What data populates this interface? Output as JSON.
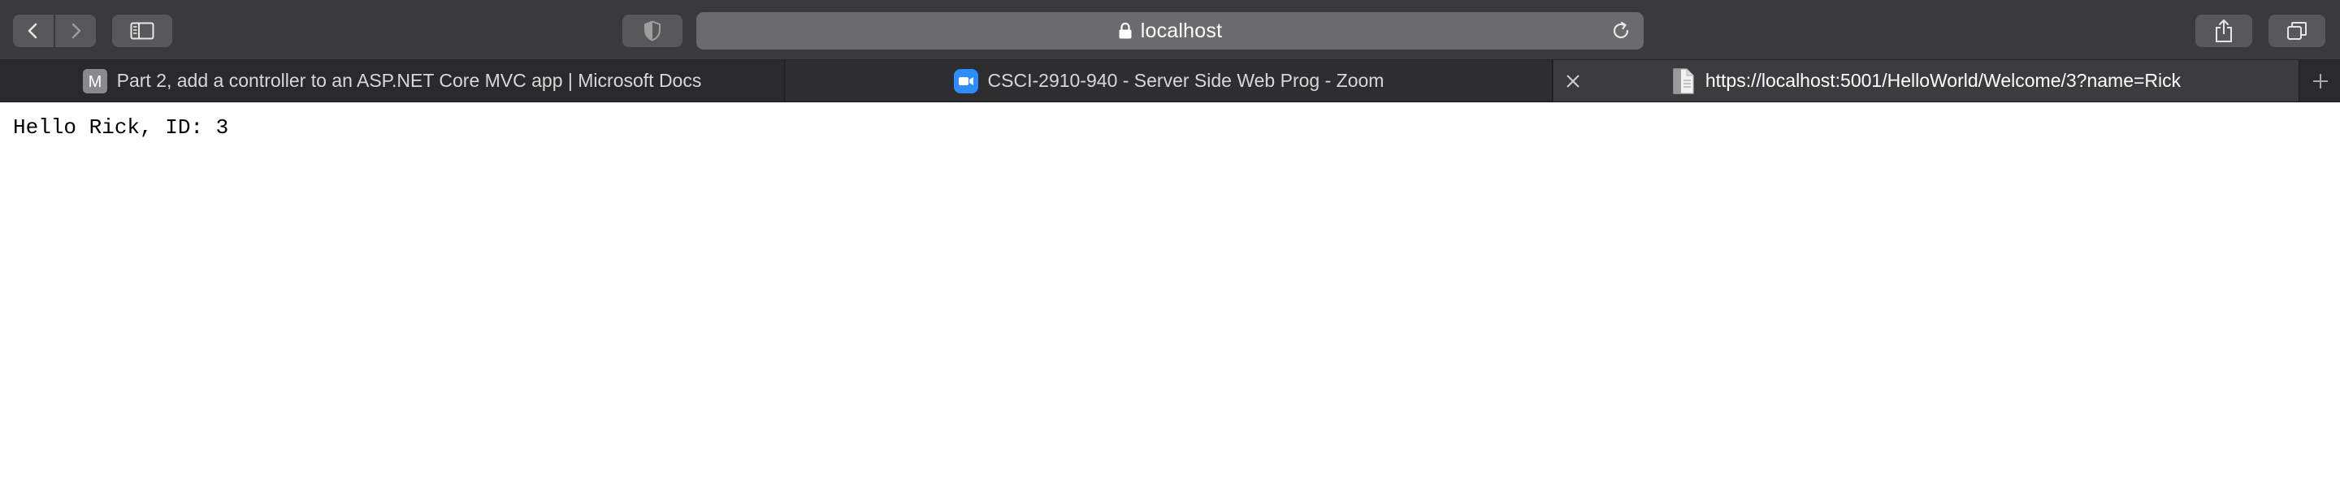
{
  "toolbar": {
    "address_host": "localhost",
    "icons": [
      "chevron-left-icon",
      "chevron-right-icon",
      "sidebar-icon",
      "shield-icon",
      "lock-icon",
      "reload-icon",
      "share-icon",
      "tabs-overview-icon"
    ]
  },
  "tabs": [
    {
      "favicon": "M",
      "title": "Part 2, add a controller to an ASP.NET Core MVC app | Microsoft Docs",
      "active": false
    },
    {
      "favicon": "zoom-icon",
      "title": "CSCI-2910-940 - Server Side Web Prog - Zoom",
      "active": false
    },
    {
      "favicon": "document-icon",
      "title": "https://localhost:5001/HelloWorld/Welcome/3?name=Rick",
      "active": true
    }
  ],
  "page": {
    "body_text": "Hello Rick, ID: 3"
  },
  "colors": {
    "toolbar_bg": "#3a3a3c",
    "tabbar_bg": "#2a2a2c",
    "address_bg": "#6b6b6d",
    "zoom_blue": "#2d8cff"
  }
}
